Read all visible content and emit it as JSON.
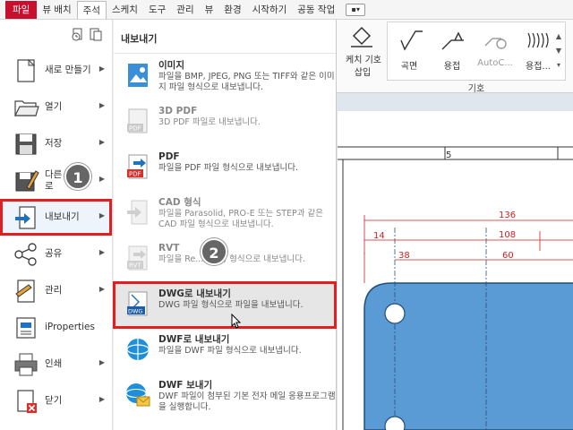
{
  "ribbon": {
    "tabs": [
      "파일",
      "뷰 배치",
      "주석",
      "스케치",
      "도구",
      "관리",
      "뷰",
      "환경",
      "시작하기",
      "공동 작업"
    ],
    "active_tab": "주석",
    "extra_label": "▪▾"
  },
  "ribbon_panel": {
    "symbol_label_1": "케치 기호",
    "symbol_label_2": "삽입",
    "buttons": [
      {
        "label": "곡면",
        "icon": "surface-texture-icon"
      },
      {
        "label": "용접",
        "icon": "weld-symbol-icon"
      },
      {
        "label": "AutoC...",
        "icon": "autocad-symbol-icon"
      },
      {
        "label": "용접...",
        "icon": "weld-bead-icon"
      }
    ],
    "group_label": "기호"
  },
  "left_menu": {
    "items": [
      {
        "label": "새로 만들기",
        "icon": "new-file-icon",
        "arrow": true
      },
      {
        "label": "열기",
        "icon": "open-folder-icon",
        "arrow": true
      },
      {
        "label": "저장",
        "icon": "save-icon",
        "arrow": true
      },
      {
        "label": "다른 이름으로",
        "icon": "save-as-icon",
        "arrow": true
      },
      {
        "label": "내보내기",
        "icon": "export-icon",
        "arrow": true
      },
      {
        "label": "공유",
        "icon": "share-icon",
        "arrow": true
      },
      {
        "label": "관리",
        "icon": "manage-icon",
        "arrow": true
      },
      {
        "label": "iProperties",
        "icon": "iproperties-icon",
        "arrow": false
      },
      {
        "label": "인쇄",
        "icon": "print-icon",
        "arrow": true
      },
      {
        "label": "닫기",
        "icon": "close-file-icon",
        "arrow": true
      }
    ],
    "selected_label": "내보내기"
  },
  "submenu": {
    "title": "내보내기",
    "items": [
      {
        "title": "이미지",
        "desc": "파일을 BMP, JPEG, PNG 또는 TIFF와 같은 이미지 파일 형식으로 내보냅니다.",
        "icon": "image-export-icon",
        "enabled": true
      },
      {
        "title": "3D PDF",
        "desc": "3D PDF 파일로 내보냅니다.",
        "icon": "3d-pdf-icon",
        "enabled": false
      },
      {
        "title": "PDF",
        "desc": "파일을 PDF 파일 형식으로 내보냅니다.",
        "icon": "pdf-icon",
        "enabled": true
      },
      {
        "title": "CAD 형식",
        "desc": "파일을 Parasolid, PRO-E 또는 STEP과 같은 CAD 파일 형식으로 내보냅니다.",
        "icon": "cad-format-icon",
        "enabled": false
      },
      {
        "title": "RVT",
        "desc": "파일을 Re...(RVT) 형식으로 내보냅니다.",
        "icon": "rvt-icon",
        "enabled": false
      },
      {
        "title": "DWG로 내보내기",
        "desc": "DWG 파일 형식으로 파일을 내보냅니다.",
        "icon": "dwg-icon",
        "enabled": true
      },
      {
        "title": "DWF로 내보내기",
        "desc": "파일을 DWF 파일 형식으로 내보냅니다.",
        "icon": "dwf-icon",
        "enabled": true
      },
      {
        "title": "DWF 보내기",
        "desc": "DWF 파일이 첨부된 기본 전자 메일 응용프로그램을 실행합니다.",
        "icon": "dwf-send-icon",
        "enabled": true
      }
    ]
  },
  "badges": [
    "1",
    "2"
  ],
  "drawing": {
    "column_label": "5",
    "dims": [
      "136",
      "14",
      "108",
      "38",
      "60"
    ]
  },
  "colors": {
    "file_tab": "#c8102e",
    "highlight_outline": "#e02020",
    "drawing_fill": "#5b9bd5",
    "dimension": "#cc2222"
  }
}
